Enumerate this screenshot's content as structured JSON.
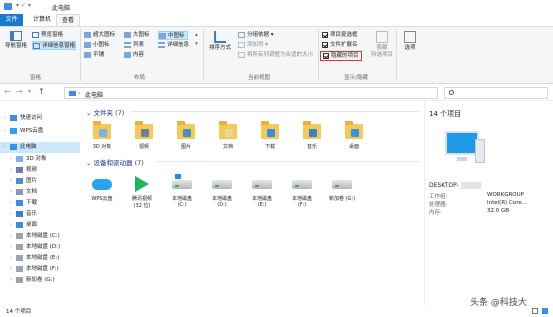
{
  "window": {
    "title": "此电脑"
  },
  "tabs": [
    "文件",
    "计算机",
    "查看"
  ],
  "ribbon": {
    "pane": {
      "nav_pane": "导航窗格",
      "preview": "预览窗格",
      "details": "详细信息窗格",
      "label": "窗格"
    },
    "layout": {
      "items": [
        "超大图标",
        "大图标",
        "中图标",
        "小图标",
        "列表",
        "详细信息",
        "平铺",
        "内容"
      ],
      "label": "布局"
    },
    "current_view": {
      "sort": "排序方式",
      "group": "分组依据",
      "add_cols": "添加列",
      "fit_cols": "将所有列调整为合适的大小",
      "label": "当前视图"
    },
    "show_hide": {
      "checkboxes": "项目复选框",
      "extensions": "文件扩展名",
      "hidden": "隐藏的项目",
      "hide_selected": "隐藏",
      "hide_selected2": "所选项目",
      "label": "显示/隐藏"
    },
    "options": "选项"
  },
  "address": {
    "path": "此电脑",
    "search_placeholder": "搜索\"此电脑\""
  },
  "nav": [
    {
      "label": "快速访问",
      "icon": "star-icon",
      "expand": true
    },
    {
      "label": "WPS云盘",
      "icon": "cloud-icon",
      "expand": true
    },
    {
      "label": "此电脑",
      "icon": "pc-icon",
      "expand": true,
      "selected": true
    },
    {
      "label": "3D 对象",
      "icon": "3d-icon",
      "expand": true
    },
    {
      "label": "视频",
      "icon": "video-icon",
      "expand": true
    },
    {
      "label": "图片",
      "icon": "image-icon",
      "expand": true
    },
    {
      "label": "文档",
      "icon": "document-icon",
      "expand": true
    },
    {
      "label": "下载",
      "icon": "download-icon",
      "expand": true
    },
    {
      "label": "音乐",
      "icon": "music-icon",
      "expand": true
    },
    {
      "label": "桌面",
      "icon": "desktop-icon",
      "expand": true
    },
    {
      "label": "本地磁盘 (C:)",
      "icon": "drive-icon",
      "expand": true
    },
    {
      "label": "本地磁盘 (D:)",
      "icon": "drive-icon",
      "expand": true
    },
    {
      "label": "本地磁盘 (E:)",
      "icon": "drive-icon",
      "expand": true
    },
    {
      "label": "本地磁盘 (F:)",
      "icon": "drive-icon",
      "expand": true
    },
    {
      "label": "新加卷 (G:)",
      "icon": "drive-icon",
      "expand": true
    }
  ],
  "folders_section": {
    "title": "文件夹 (7)"
  },
  "folders": [
    "3D 对象",
    "视频",
    "图片",
    "文档",
    "下载",
    "音乐",
    "桌面"
  ],
  "devices_section": {
    "title": "设备和驱动器 (7)"
  },
  "devices": [
    {
      "label": "WPS云盘",
      "sub": ""
    },
    {
      "label": "腾讯视频",
      "sub": "(32 位)"
    },
    {
      "label": "本地磁盘",
      "sub": "(C:)"
    },
    {
      "label": "本地磁盘",
      "sub": "(D:)"
    },
    {
      "label": "本地磁盘",
      "sub": "(E:)"
    },
    {
      "label": "本地磁盘",
      "sub": "(F:)"
    },
    {
      "label": "新加卷 (G:)",
      "sub": ""
    }
  ],
  "details": {
    "count": "14 个项目",
    "name": "DESKTOP-",
    "rows": [
      {
        "k": "工作组:",
        "v": "WORKGROUP"
      },
      {
        "k": "处理器:",
        "v": "Intel(R) Core..."
      },
      {
        "k": "内存:",
        "v": "32.0 GB"
      }
    ]
  },
  "status": {
    "count": "14 个项目"
  },
  "watermark": "头条 @科技大",
  "colors": {
    "accent": "#1979ca",
    "highlight": "#cce8ff",
    "redbox": "#e0362c"
  }
}
